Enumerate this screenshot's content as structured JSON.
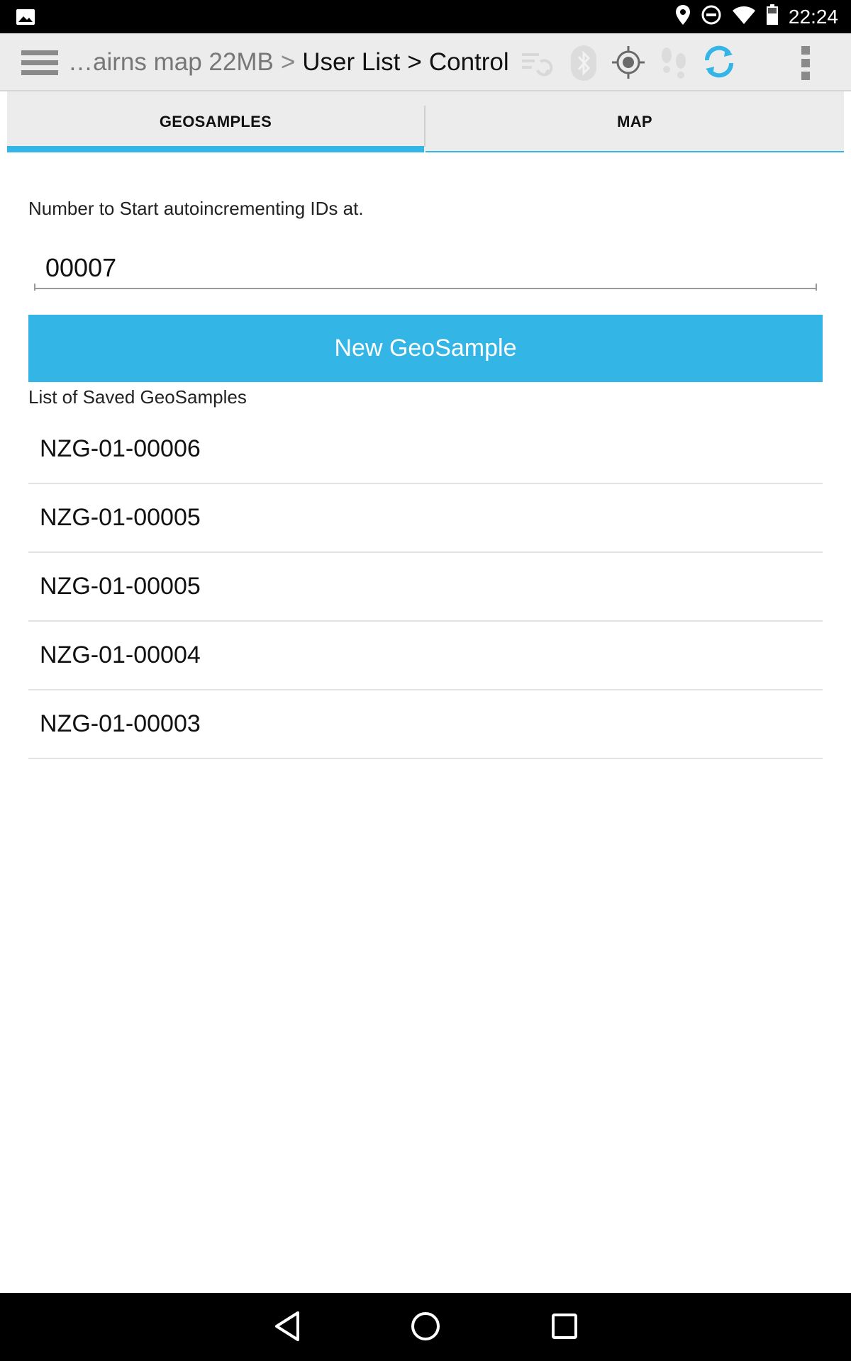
{
  "status_bar": {
    "time": "22:24",
    "icons": [
      "image-icon",
      "location-pin-icon",
      "do-not-disturb-icon",
      "wifi-icon",
      "battery-icon"
    ]
  },
  "action_bar": {
    "breadcrumb": {
      "prefix": "…airns map 22MB",
      "separator": ">",
      "middle": "User List",
      "current": "Control"
    },
    "icons": [
      "hamburger-menu-icon",
      "sync-list-icon",
      "bluetooth-icon",
      "gps-target-icon",
      "footsteps-icon",
      "refresh-icon",
      "overflow-menu-icon"
    ],
    "accent_color": "#33b5e5"
  },
  "tabs": [
    {
      "label": "GEOSAMPLES",
      "selected": true
    },
    {
      "label": "MAP",
      "selected": false
    }
  ],
  "form": {
    "id_start_label": "Number to Start autoincrementing IDs at.",
    "id_start_value": "00007",
    "new_button_label": "New GeoSample"
  },
  "saved_list": {
    "label": "List of Saved GeoSamples",
    "items": [
      "NZG-01-00006",
      "NZG-01-00005",
      "NZG-01-00005",
      "NZG-01-00004",
      "NZG-01-00003"
    ]
  },
  "nav_bar": {
    "buttons": [
      "back-icon",
      "home-icon",
      "recents-icon"
    ]
  }
}
